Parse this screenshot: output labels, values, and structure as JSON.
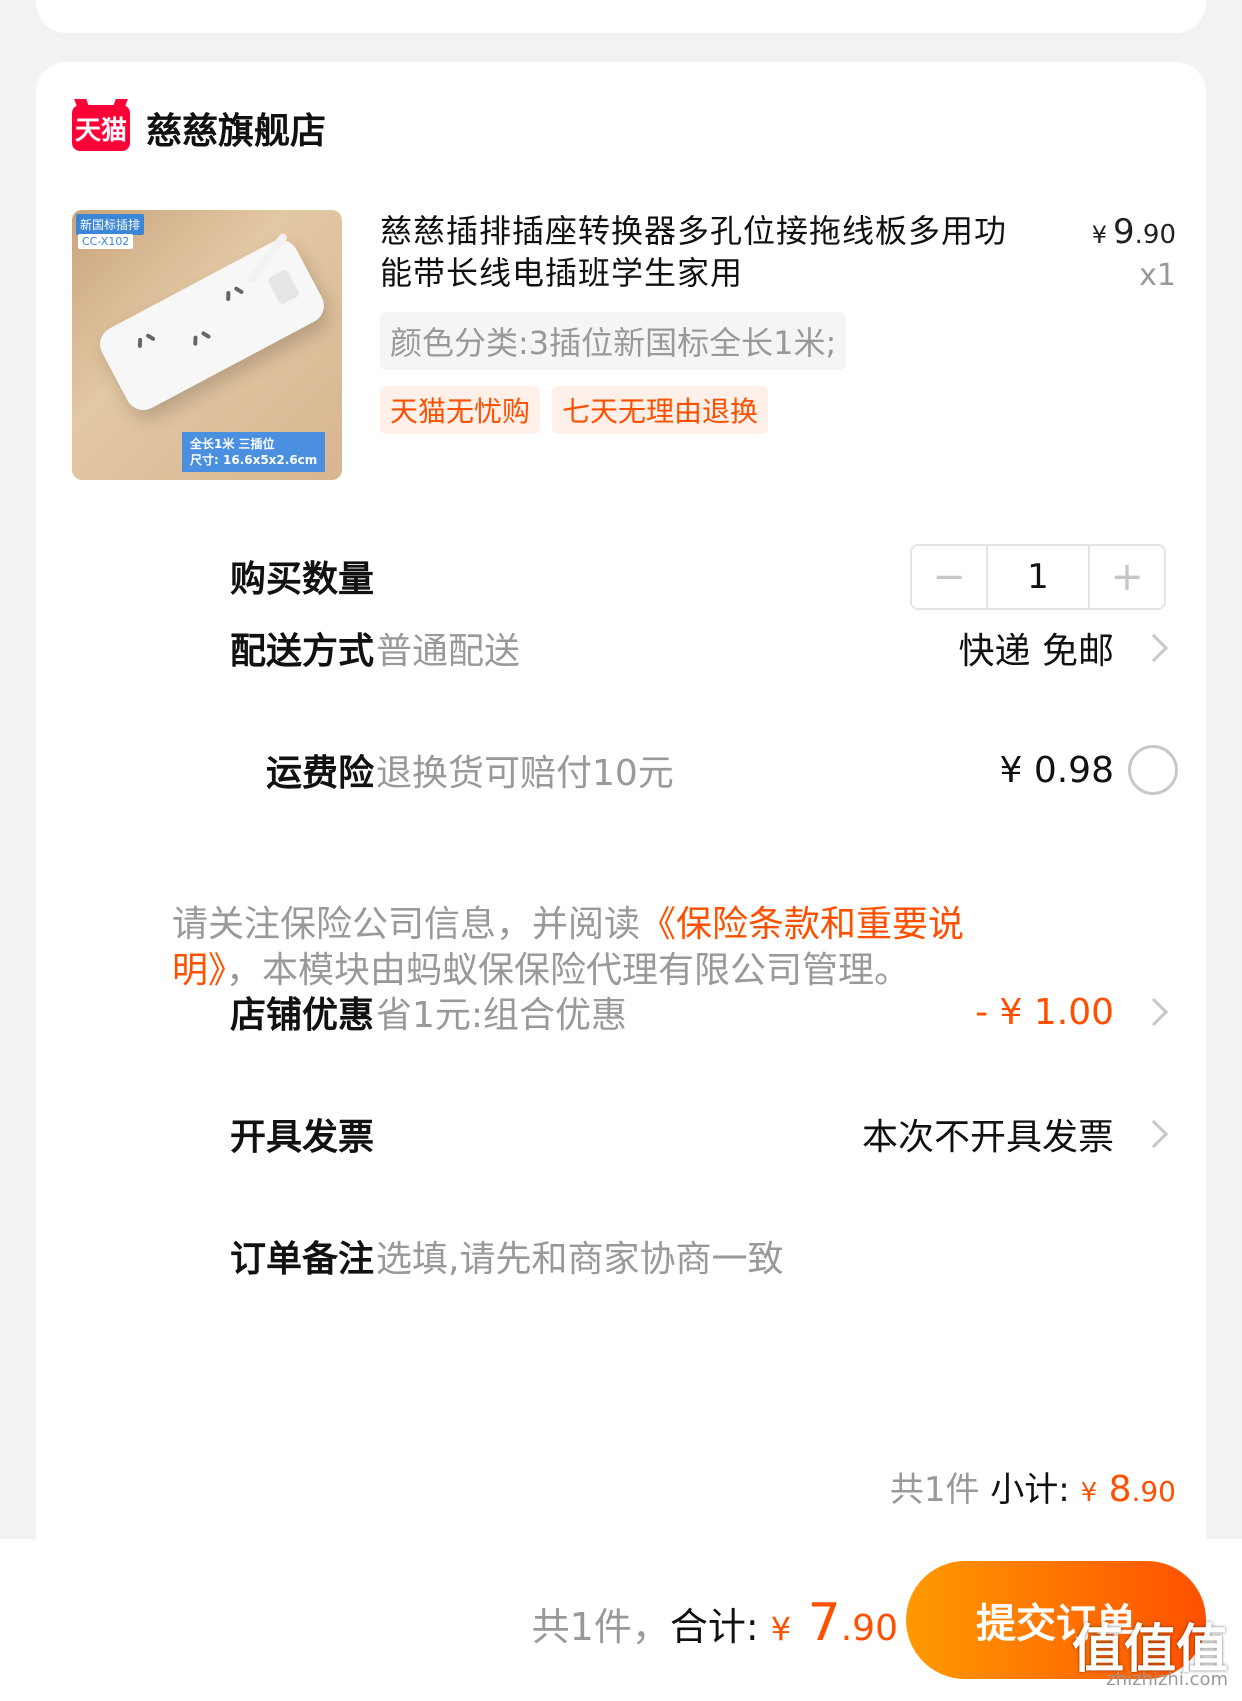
{
  "shop": {
    "logo_text": "天猫",
    "name": "慈慈旗舰店"
  },
  "product": {
    "image_tag_top": "新国标插排",
    "image_tag_model": "CC-X102",
    "image_caption_line1": "全长1米  三插位",
    "image_caption_line2": "尺寸: 16.6x5x2.6cm",
    "title": "慈慈插排插座转换器多孔位接拖线板多用功能带长线电插班学生家用",
    "price_currency": "¥",
    "price_int": "9",
    "price_dec": ".90",
    "quantity_text": "x1",
    "sku": "颜色分类:3插位新国标全长1米;",
    "tags": [
      "天猫无忧购",
      "七天无理由退换"
    ]
  },
  "quantity": {
    "label": "购买数量",
    "minus": "−",
    "value": "1",
    "plus": "+"
  },
  "delivery": {
    "label": "配送方式",
    "sub": "普通配送",
    "value": "快递 免邮"
  },
  "insurance": {
    "label": "运费险",
    "sub": "退换货可赔付10元",
    "value": "¥ 0.98"
  },
  "notice": {
    "prefix": "请关注保险公司信息，并阅读",
    "link": "《保险条款和重要说明》",
    "suffix": "，本模块由蚂蚁保保险代理有限公司管理。"
  },
  "discount": {
    "label": "店铺优惠",
    "sub": "省1元:组合优惠",
    "value": "- ¥ 1.00"
  },
  "invoice": {
    "label": "开具发票",
    "value": "本次不开具发票"
  },
  "note": {
    "label": "订单备注",
    "placeholder": "选填,请先和商家协商一致"
  },
  "subtotal": {
    "count": "共1件",
    "label": "小计:",
    "currency": "¥",
    "int": "8",
    "dec": ".90"
  },
  "footer": {
    "count": "共1件，",
    "label": "合计:",
    "currency": "¥",
    "int": "7",
    "dec": ".90",
    "submit": "提交订单",
    "watermark": "值值值",
    "watermark_url": "zhizhizhi.com"
  },
  "colors": {
    "accent": "#ff5000",
    "brand_tmall": "#ff0036",
    "muted": "#999999"
  }
}
